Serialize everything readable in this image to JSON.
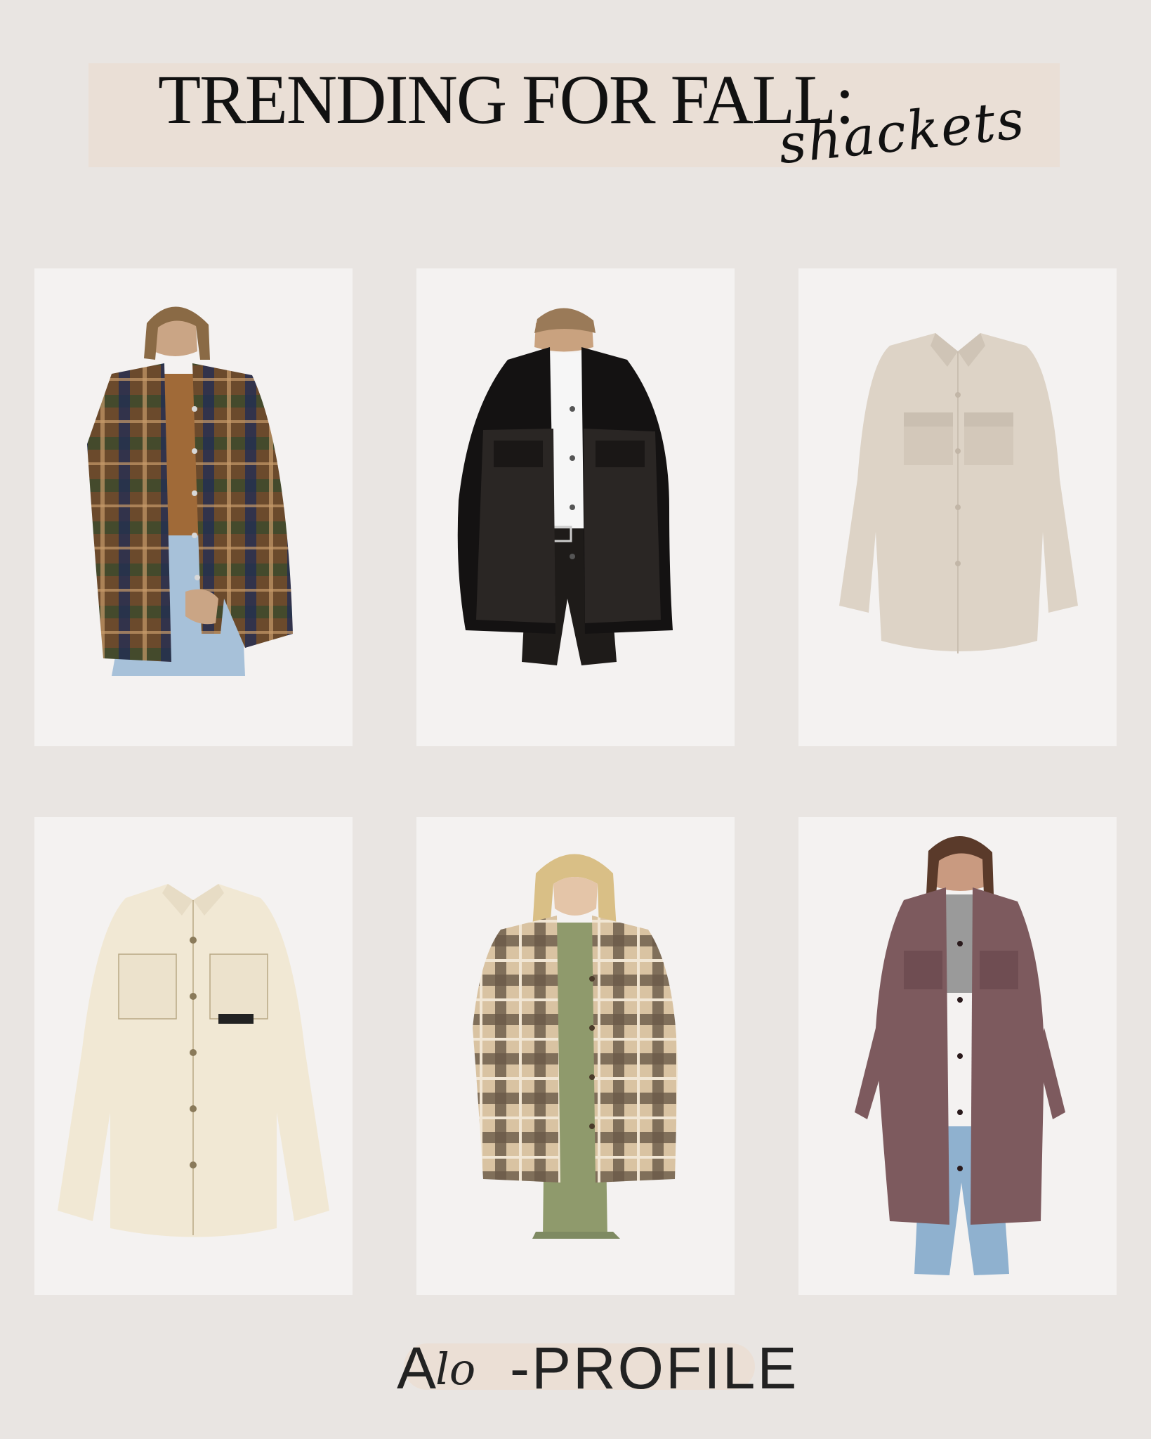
{
  "header": {
    "title": "TRENDING FOR FALL:",
    "script_word": "shackets"
  },
  "products": [
    {
      "icon": "plaid-shacket-model-image"
    },
    {
      "icon": "black-leather-shacket-image"
    },
    {
      "icon": "oatmeal-wool-shacket-image"
    },
    {
      "icon": "cream-denim-shacket-image"
    },
    {
      "icon": "beige-plaid-shacket-model-image"
    },
    {
      "icon": "mauve-long-shacket-model-image"
    }
  ],
  "footer": {
    "brand_a": "A",
    "brand_lo": "lo",
    "brand_rest": "-PROFILE"
  }
}
